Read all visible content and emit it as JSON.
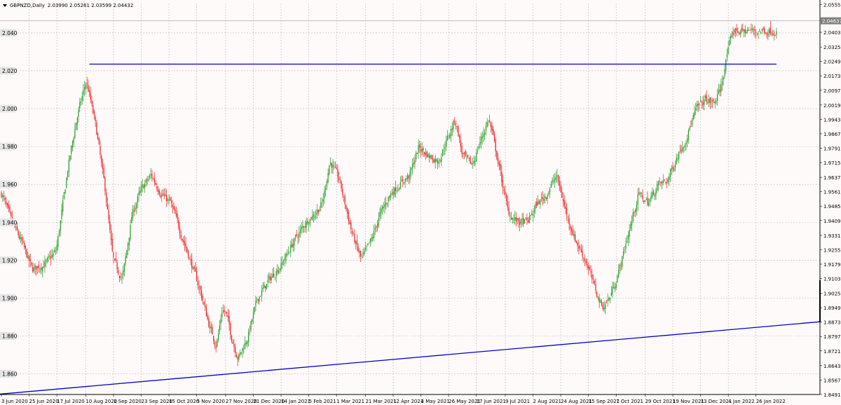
{
  "header": {
    "symbol": "GBPNZD,Daily",
    "ohlc": "2.03990 2.05261 2.03599 2.04432"
  },
  "colors": {
    "background": "#fffafa",
    "grid": "#b9b9b9",
    "bull": "#1f9a1f",
    "bear": "#e81a1a",
    "trendline": "#0000cc",
    "axis": "#000000"
  },
  "chart_data": {
    "type": "candlestick",
    "symbol": "GBPNZD",
    "timeframe": "Daily",
    "current_price_label": "2.04637",
    "current_price": 2.04637,
    "ylim": [
      1.8491,
      2.0555
    ],
    "grid": true,
    "left_y_labels": [
      "2.040",
      "2.020",
      "2.000",
      "1.980",
      "1.960",
      "1.940",
      "1.920",
      "1.900",
      "1.880",
      "1.860"
    ],
    "left_y_values": [
      2.04,
      2.02,
      2.0,
      1.98,
      1.96,
      1.94,
      1.92,
      1.9,
      1.88,
      1.86
    ],
    "right_y_labels": [
      "2.05551",
      "2.04637",
      "2.04032",
      "2.03252",
      "2.02492",
      "2.01732",
      "2.00972",
      "2.00192",
      "1.99432",
      "1.98672",
      "1.97912",
      "1.97152",
      "1.96372",
      "1.95612",
      "1.94852",
      "1.94092",
      "1.93312",
      "1.92552",
      "1.91792",
      "1.91032",
      "1.90252",
      "1.89492",
      "1.88732",
      "1.87972",
      "1.87212",
      "1.86432",
      "1.85672",
      "1.84912"
    ],
    "x_labels": [
      "3 Jun 2020",
      "25 Jun 2020",
      "17 Jul 2020",
      "10 Aug 2020",
      "1 Sep 2020",
      "23 Sep 2020",
      "15 Oct 2020",
      "5 Nov 2020",
      "27 Nov 2020",
      "21 Dec 2020",
      "14 Jan 2021",
      "5 Feb 2021",
      "1 Mar 2021",
      "21 Mar 2021",
      "12 Apr 2021",
      "4 May 2021",
      "26 May 2021",
      "17 Jun 2021",
      "9 Jul 2021",
      "2 Aug 2021",
      "24 Aug 2021",
      "15 Sep 2021",
      "7 Oct 2021",
      "29 Oct 2021",
      "19 Nov 2021",
      "13 Dec 2021",
      "4 Jan 2022",
      "26 Jan 2022"
    ],
    "anchors": [
      [
        0,
        1.955
      ],
      [
        8,
        1.94
      ],
      [
        16,
        1.93
      ],
      [
        25,
        1.915
      ],
      [
        36,
        1.918
      ],
      [
        45,
        1.925
      ],
      [
        55,
        1.97
      ],
      [
        62,
        1.995
      ],
      [
        70,
        2.015
      ],
      [
        78,
        1.99
      ],
      [
        86,
        1.955
      ],
      [
        92,
        1.92
      ],
      [
        100,
        1.91
      ],
      [
        108,
        1.945
      ],
      [
        116,
        1.958
      ],
      [
        124,
        1.965
      ],
      [
        132,
        1.955
      ],
      [
        140,
        1.95
      ],
      [
        148,
        1.935
      ],
      [
        156,
        1.92
      ],
      [
        164,
        1.905
      ],
      [
        172,
        1.885
      ],
      [
        178,
        1.875
      ],
      [
        183,
        1.895
      ],
      [
        187,
        1.89
      ],
      [
        190,
        1.88
      ],
      [
        196,
        1.868
      ],
      [
        204,
        1.88
      ],
      [
        212,
        1.9
      ],
      [
        222,
        1.91
      ],
      [
        232,
        1.918
      ],
      [
        242,
        1.93
      ],
      [
        252,
        1.94
      ],
      [
        260,
        1.945
      ],
      [
        266,
        1.95
      ],
      [
        272,
        1.973
      ],
      [
        280,
        1.962
      ],
      [
        290,
        1.935
      ],
      [
        298,
        1.92
      ],
      [
        306,
        1.93
      ],
      [
        314,
        1.945
      ],
      [
        322,
        1.955
      ],
      [
        330,
        1.96
      ],
      [
        338,
        1.965
      ],
      [
        346,
        1.98
      ],
      [
        354,
        1.975
      ],
      [
        362,
        1.972
      ],
      [
        370,
        1.985
      ],
      [
        376,
        1.995
      ],
      [
        382,
        1.975
      ],
      [
        390,
        1.97
      ],
      [
        398,
        1.985
      ],
      [
        404,
        1.995
      ],
      [
        412,
        1.97
      ],
      [
        420,
        1.945
      ],
      [
        428,
        1.94
      ],
      [
        436,
        1.94
      ],
      [
        444,
        1.95
      ],
      [
        452,
        1.955
      ],
      [
        460,
        1.965
      ],
      [
        468,
        1.945
      ],
      [
        476,
        1.93
      ],
      [
        484,
        1.92
      ],
      [
        492,
        1.905
      ],
      [
        498,
        1.895
      ],
      [
        504,
        1.9
      ],
      [
        512,
        1.915
      ],
      [
        520,
        1.935
      ],
      [
        528,
        1.955
      ],
      [
        536,
        1.95
      ],
      [
        544,
        1.96
      ],
      [
        552,
        1.962
      ],
      [
        560,
        1.975
      ],
      [
        568,
        1.985
      ],
      [
        576,
        2.0
      ],
      [
        584,
        2.005
      ],
      [
        590,
        2.002
      ],
      [
        596,
        2.01
      ],
      [
        602,
        2.03
      ],
      [
        607,
        2.042
      ],
      [
        612,
        2.041
      ]
    ],
    "trendlines": [
      {
        "name": "resistance",
        "from": {
          "index": 73,
          "price": 2.0235
        },
        "to": {
          "index": 643,
          "price": 2.0235
        }
      },
      {
        "name": "support",
        "from": {
          "index": 0,
          "price": 1.8493
        },
        "to": {
          "index": 690,
          "price": 1.8875
        }
      }
    ]
  }
}
